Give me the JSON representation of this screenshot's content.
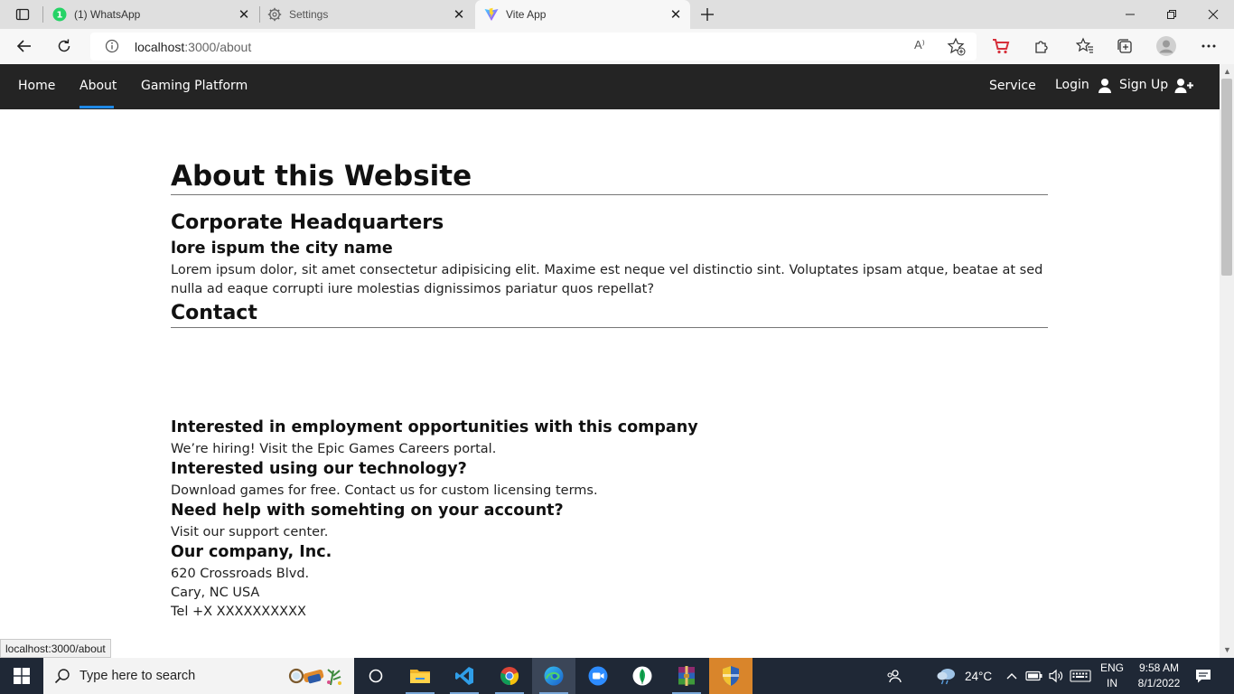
{
  "browser": {
    "tabs": [
      {
        "label": "(1) WhatsApp",
        "badge": "1"
      },
      {
        "label": "Settings"
      },
      {
        "label": "Vite App",
        "active": true
      }
    ],
    "close_glyph": "✕",
    "new_tab_glyph": "+",
    "url_host": "localhost",
    "url_path": ":3000/about",
    "read_aloud": "A⁾"
  },
  "site": {
    "nav": {
      "home": "Home",
      "about": "About",
      "gaming": "Gaming Platform",
      "service": "Service",
      "login": "Login",
      "signup": "Sign Up"
    },
    "title": "About this Website",
    "hq_heading": "Corporate Headquarters",
    "city_heading": "lore ispum the city name",
    "hq_text": "Lorem ipsum dolor, sit amet consectetur adipisicing elit. Maxime est neque vel distinctio sint. Voluptates ipsam atque, beatae at sed nulla ad eaque corrupti iure molestias dignissimos pariatur quos repellat?",
    "contact_heading": "Contact",
    "employment_heading": "Interested in employment opportunities with this company",
    "employment_text": "We’re hiring! Visit the Epic Games Careers portal.",
    "tech_heading": "Interested using our technology?",
    "tech_text": "Download games for free. Contact us for custom licensing terms.",
    "help_heading": "Need help with somehting on your account?",
    "help_text": "Visit our support center.",
    "company_heading": "Our company, Inc.",
    "address_line1": "620 Crossroads Blvd.",
    "address_line2": "Cary, NC USA",
    "phone": "Tel +X XXXXXXXXXX"
  },
  "status_url": "localhost:3000/about",
  "taskbar": {
    "search_placeholder": "Type here to search",
    "weather": "24°C",
    "lang_top": "ENG",
    "lang_bottom": "IN",
    "time": "9:58 AM",
    "date": "8/1/2022"
  },
  "colors": {
    "nav_bg": "#242424",
    "nav_active_underline": "#1e88e5",
    "taskbar_bg": "#1f2836"
  }
}
